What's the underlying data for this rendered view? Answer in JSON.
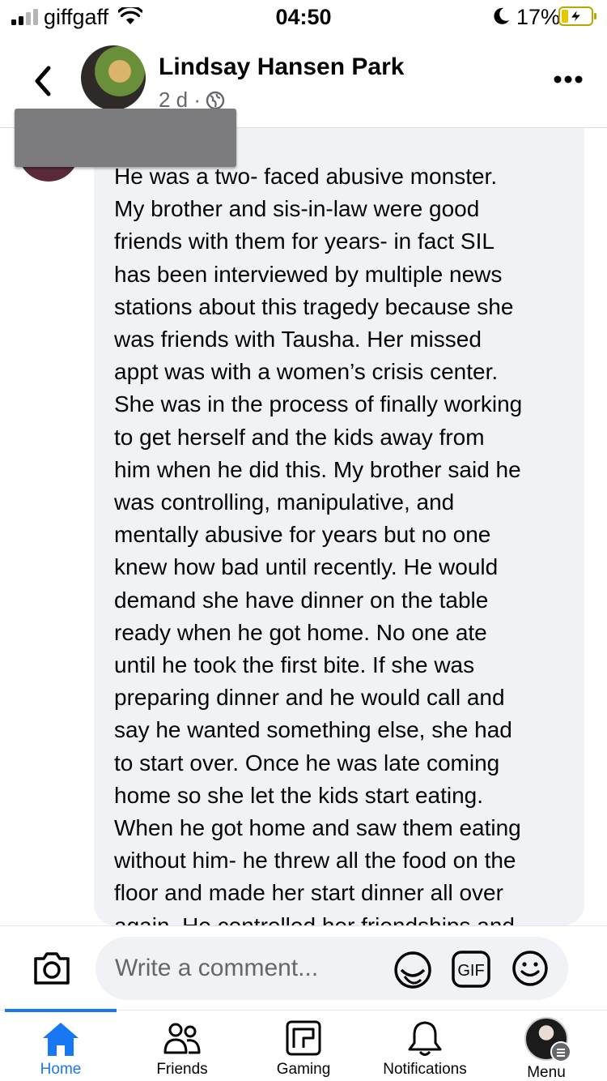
{
  "status_bar": {
    "carrier": "giffgaff",
    "time": "04:50",
    "battery_percent": "17%"
  },
  "header": {
    "poster_name": "Lindsay Hansen Park",
    "post_age": "2 d ·"
  },
  "comment": {
    "lines": [
      "He was a two- faced abusive monster.",
      "My brother and sis-in-law were good",
      "friends with them for years- in fact SIL",
      "has been interviewed by multiple news",
      "stations about this tragedy because she",
      "was friends with Tausha. Her missed",
      "appt was with a women’s crisis center.",
      "She was in the process of finally working",
      "to get herself and the kids away from",
      "him when he did this. My brother said he",
      "was controlling, manipulative, and",
      "mentally abusive for years but no one",
      "knew how bad until recently. He would",
      "demand she have dinner on the table",
      "ready when he got home. No one ate",
      "until he took the first bite. If she was",
      "preparing dinner and he would call and",
      "say he wanted something else, she had",
      "to start over. Once he was late coming",
      "home so she let the kids start eating.",
      "When he got home and saw them eating",
      "without him- he threw all the food on the",
      "floor and made her start dinner all over",
      "again.  He controlled her friendships and"
    ]
  },
  "comment_bar": {
    "placeholder": "Write a comment..."
  },
  "nav": {
    "home": "Home",
    "friends": "Friends",
    "gaming": "Gaming",
    "notifications": "Notifications",
    "menu": "Menu"
  },
  "colors": {
    "accent": "#1877f2",
    "bubble": "#f0f2f5",
    "secondary_text": "#65676b"
  },
  "icons": [
    "signal-icon",
    "wifi-icon",
    "moon-icon",
    "battery-charging-icon",
    "back-chevron-icon",
    "globe-icon",
    "more-dots-icon",
    "camera-icon",
    "sticker-icon",
    "gif-icon",
    "emoji-icon",
    "home-icon",
    "friends-icon",
    "gaming-icon",
    "bell-icon"
  ]
}
